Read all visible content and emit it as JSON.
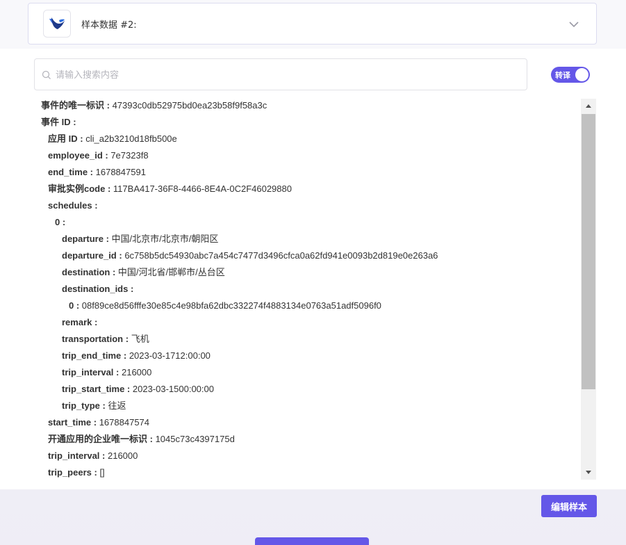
{
  "sample": {
    "title": "样本数据 #2:"
  },
  "search": {
    "placeholder": "请输入搜索内容",
    "value": ""
  },
  "toggle": {
    "label": "转译",
    "on": true
  },
  "tree": [
    {
      "indent": 0,
      "key": "事件的唯一标识 :",
      "value": "47393c0db52975bd0ea23b58f9f58a3c"
    },
    {
      "indent": 0,
      "key": "事件 ID :",
      "value": ""
    },
    {
      "indent": 1,
      "key": "应用 ID :",
      "value": "cli_a2b3210d18fb500e"
    },
    {
      "indent": 1,
      "key": "employee_id :",
      "value": "7e7323f8"
    },
    {
      "indent": 1,
      "key": "end_time :",
      "value": "1678847591"
    },
    {
      "indent": 1,
      "key": "审批实例code :",
      "value": "117BA417-36F8-4466-8E4A-0C2F46029880"
    },
    {
      "indent": 1,
      "key": "schedules :",
      "value": ""
    },
    {
      "indent": 2,
      "key": "0 :",
      "value": ""
    },
    {
      "indent": 3,
      "key": "departure :",
      "value": "中国/北京市/北京市/朝阳区"
    },
    {
      "indent": 3,
      "key": "departure_id :",
      "value": "6c758b5dc54930abc7a454c7477d3496cfca0a62fd941e0093b2d819e0e263a6"
    },
    {
      "indent": 3,
      "key": "destination :",
      "value": "中国/河北省/邯郸市/丛台区"
    },
    {
      "indent": 3,
      "key": "destination_ids :",
      "value": ""
    },
    {
      "indent": 4,
      "key": "0 :",
      "value": "08f89ce8d56fffe30e85c4e98bfa62dbc332274f4883134e0763a51adf5096f0"
    },
    {
      "indent": 3,
      "key": "remark :",
      "value": ""
    },
    {
      "indent": 3,
      "key": "transportation :",
      "value": "飞机"
    },
    {
      "indent": 3,
      "key": "trip_end_time :",
      "value": "2023-03-1712:00:00"
    },
    {
      "indent": 3,
      "key": "trip_interval :",
      "value": "216000"
    },
    {
      "indent": 3,
      "key": "trip_start_time :",
      "value": "2023-03-1500:00:00"
    },
    {
      "indent": 3,
      "key": "trip_type :",
      "value": "往返"
    },
    {
      "indent": 1,
      "key": "start_time :",
      "value": "1678847574"
    },
    {
      "indent": 1,
      "key": "开通应用的企业唯一标识 :",
      "value": "1045c73c4397175d"
    },
    {
      "indent": 1,
      "key": "trip_interval :",
      "value": "216000"
    },
    {
      "indent": 1,
      "key": "trip_peers :",
      "value": "[]"
    }
  ],
  "actions": {
    "edit_sample": "编辑样本"
  },
  "colors": {
    "accent": "#6457e8",
    "border": "#dcdcf0"
  },
  "icons": {
    "logo": "app-logo-icon",
    "chevron": "chevron-down-icon",
    "search": "search-icon"
  }
}
